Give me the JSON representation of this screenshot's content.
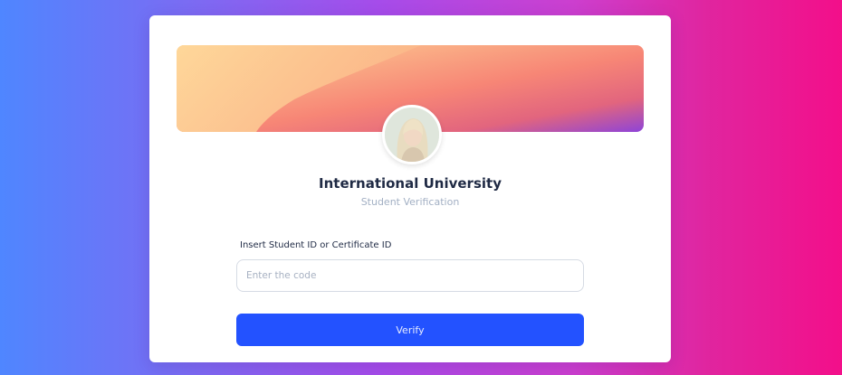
{
  "header": {
    "institution_name": "International University",
    "subtitle": "Student Verification"
  },
  "form": {
    "field_label": "Insert Student ID or Certificate ID",
    "code_value": "",
    "code_placeholder": "Enter the code",
    "verify_label": "Verify"
  },
  "colors": {
    "primary_button": "#2352ff",
    "title_text": "#1f2a44",
    "muted_text": "#a3b0c4"
  }
}
